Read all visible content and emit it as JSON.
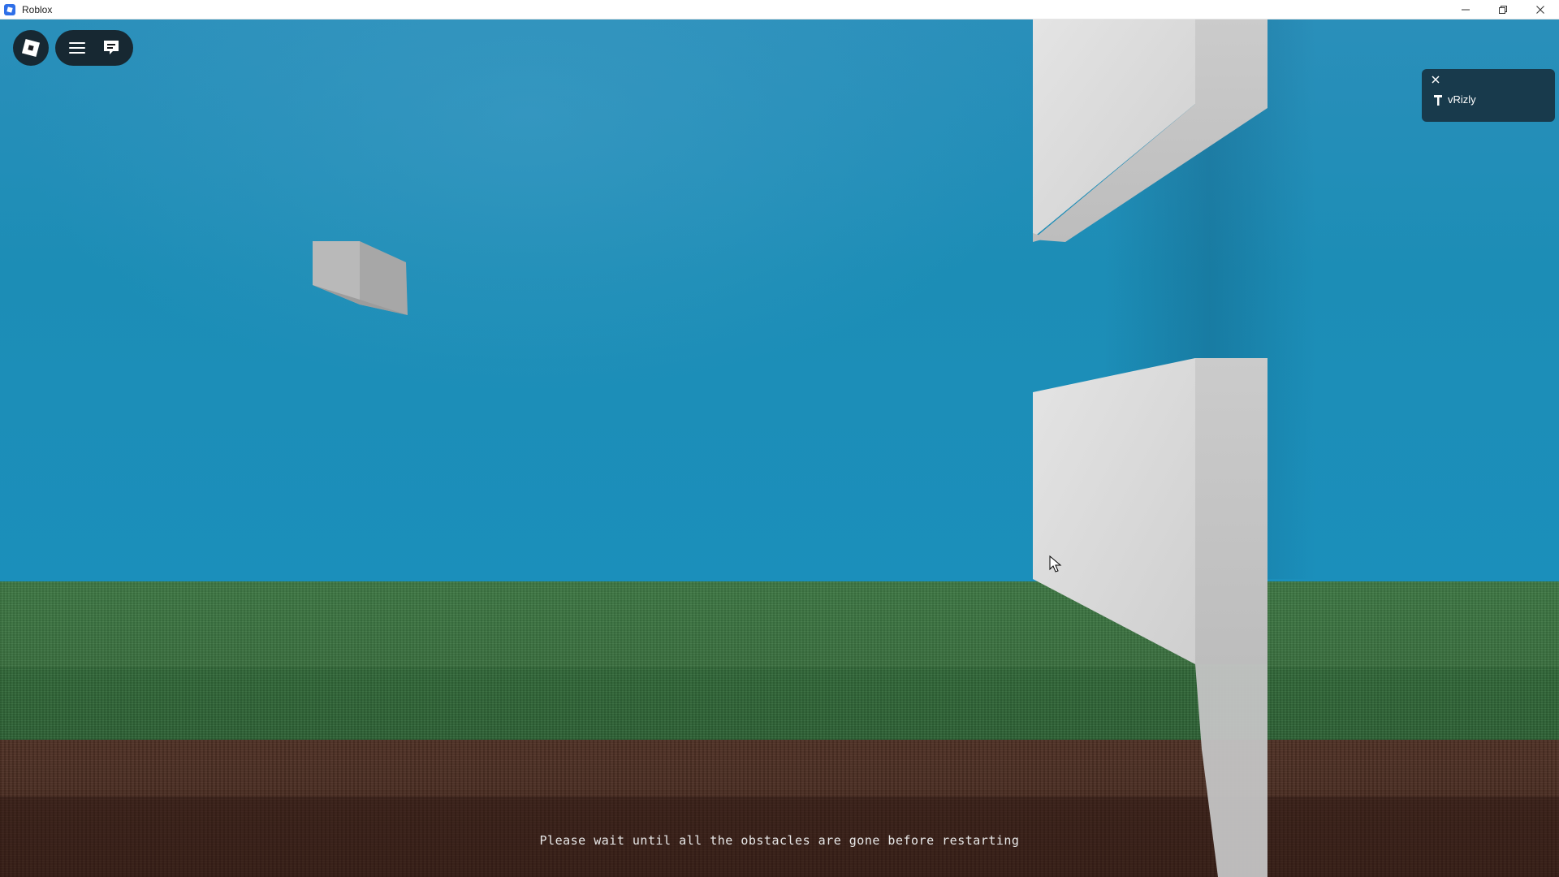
{
  "window": {
    "title": "Roblox",
    "controls": [
      "minimize-icon",
      "maximize-icon",
      "close-icon"
    ]
  },
  "hud": {
    "roblox_menu_icon": "roblox-logo-icon",
    "menu_icon": "hamburger-menu-icon",
    "chat_icon": "chat-icon"
  },
  "playerlist": {
    "close_icon": "close-icon",
    "players": [
      {
        "name": "vRizly",
        "icon": "player-icon"
      }
    ]
  },
  "status_message": "Please wait until all the obstacles are gone before restarting",
  "colors": {
    "sky": "#1b8fbb",
    "grass": "#3d7542",
    "dirt": "#4a2d22",
    "obstacle": "#d9d9d9",
    "floating_cube": "#b4b4b4",
    "hud_dark": "#14161a"
  }
}
